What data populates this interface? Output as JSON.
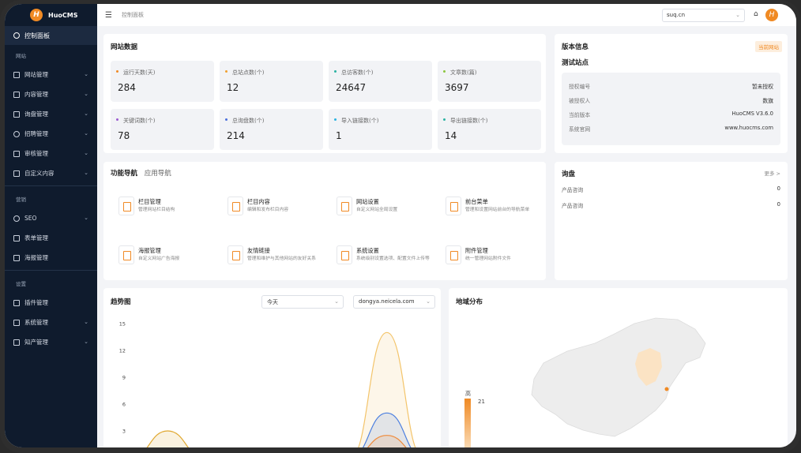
{
  "app": {
    "name": "HuoCMS",
    "logo_char": "H"
  },
  "sidebar": {
    "active": "控制面板",
    "sections": [
      {
        "title": "网站",
        "items": [
          "网站管理",
          "内容管理",
          "询盘管理",
          "招聘管理",
          "审核管理",
          "自定义内容"
        ]
      },
      {
        "title": "营销",
        "items": [
          "SEO",
          "表单管理",
          "海报管理"
        ]
      },
      {
        "title": "设置",
        "items": [
          "插件管理",
          "系统管理",
          "知产管理"
        ]
      }
    ]
  },
  "topbar": {
    "breadcrumb": "控制面板",
    "site_select": "suq.cn"
  },
  "site_data": {
    "title": "网站数据",
    "stats": [
      {
        "label": "运行天数(天)",
        "value": "284",
        "color": "#f08a24"
      },
      {
        "label": "总站点数(个)",
        "value": "12",
        "color": "#f0a030"
      },
      {
        "label": "总访客数(个)",
        "value": "24647",
        "color": "#2bb3a3"
      },
      {
        "label": "文章数(篇)",
        "value": "3697",
        "color": "#8cc63f"
      },
      {
        "label": "关键词数(个)",
        "value": "78",
        "color": "#9b59d0"
      },
      {
        "label": "总询盘数(个)",
        "value": "214",
        "color": "#4a6fdc"
      },
      {
        "label": "导入链接数(个)",
        "value": "1",
        "color": "#2bb3e0"
      },
      {
        "label": "导出链接数(个)",
        "value": "14",
        "color": "#2bb3a3"
      }
    ]
  },
  "version": {
    "title": "版本信息",
    "tag": "当前网站",
    "site_name": "测试站点",
    "rows": [
      {
        "label": "授权编号",
        "value": "暂未授权"
      },
      {
        "label": "被授权人",
        "value": "数旗"
      },
      {
        "label": "当前版本",
        "value": "HuoCMS V3.6.0"
      },
      {
        "label": "系统官网",
        "value": "www.huocms.com"
      }
    ]
  },
  "feature_nav": {
    "tab_active": "功能导航",
    "tab_other": "应用导航",
    "items": [
      {
        "name": "栏目管理",
        "desc": "管理网站栏目结构"
      },
      {
        "name": "栏目内容",
        "desc": "编辑和发布栏目内容"
      },
      {
        "name": "网站设置",
        "desc": "自定义网站全局设置"
      },
      {
        "name": "前台菜单",
        "desc": "管理和设置网站前台的导航菜单"
      },
      {
        "name": "海报管理",
        "desc": "自定义网站广告海报"
      },
      {
        "name": "友情链接",
        "desc": "管理和维护与其他网站的友好关系"
      },
      {
        "name": "系统设置",
        "desc": "系统级别设置选项、配置文件上传等"
      },
      {
        "name": "附件管理",
        "desc": "统一管理网站附件文件"
      }
    ]
  },
  "inquiry": {
    "title": "询盘",
    "more": "更多 >",
    "rows": [
      {
        "label": "产品咨询",
        "value": "0"
      },
      {
        "label": "产品咨询",
        "value": "0"
      }
    ]
  },
  "trend": {
    "title": "趋势图",
    "period": "今天",
    "domain": "dongya.neicela.com"
  },
  "map": {
    "title": "地域分布",
    "legend_high": "高",
    "legend_value": "21"
  },
  "chart_data": {
    "type": "area",
    "y_ticks": [
      "15",
      "12",
      "9",
      "6",
      "3"
    ],
    "ylim": [
      0,
      15
    ],
    "series": [
      {
        "values": [
          0,
          0,
          0,
          0,
          0,
          0,
          0,
          14,
          0
        ],
        "color": "#f3c46a"
      },
      {
        "values": [
          0,
          0,
          0,
          0,
          0,
          0,
          0,
          5,
          0
        ],
        "color": "#4a7ee0"
      },
      {
        "values": [
          0,
          0,
          0,
          0,
          0,
          0,
          0,
          2.5,
          0
        ],
        "color": "#ef8a3a"
      },
      {
        "values": [
          0,
          3,
          0,
          0,
          0,
          0,
          0,
          0,
          0
        ],
        "color": "#e0a830"
      }
    ]
  }
}
